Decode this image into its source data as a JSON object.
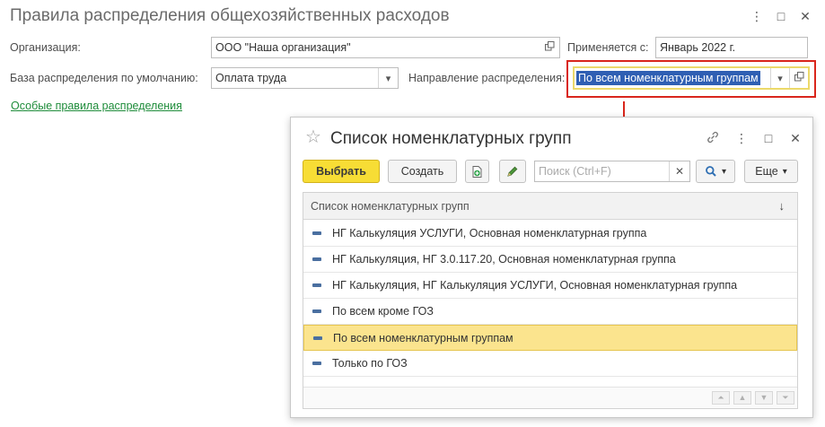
{
  "window": {
    "title": "Правила распределения общехозяйственных расходов",
    "menu_icon": "⋮",
    "maximize_icon": "□",
    "close_icon": "✕"
  },
  "form": {
    "org_label": "Организация:",
    "org_value": "ООО \"Наша организация\"",
    "applies_label": "Применяется с:",
    "applies_value": "Январь 2022 г.",
    "base_label": "База распределения по умолчанию:",
    "base_value": "Оплата труда",
    "direction_label": "Направление распределения:",
    "direction_value": "По всем номенклатурным группам",
    "special_rules_link": "Особые правила распределения"
  },
  "popup": {
    "title": "Список номенклатурных групп",
    "toolbar": {
      "select_label": "Выбрать",
      "create_label": "Создать",
      "search_placeholder": "Поиск (Ctrl+F)",
      "more_label": "Еще"
    },
    "table": {
      "column_header": "Список номенклатурных групп",
      "rows": [
        {
          "label": "НГ Калькуляция УСЛУГИ, Основная номенклатурная группа",
          "selected": false
        },
        {
          "label": "НГ Калькуляция, НГ 3.0.117.20, Основная номенклатурная группа",
          "selected": false
        },
        {
          "label": "НГ Калькуляция, НГ Калькуляция УСЛУГИ, Основная номенклатурная группа",
          "selected": false
        },
        {
          "label": "По всем кроме ГОЗ",
          "selected": false
        },
        {
          "label": "По всем номенклатурным группам",
          "selected": true
        },
        {
          "label": "Только по ГОЗ",
          "selected": false
        }
      ]
    }
  },
  "colors": {
    "highlight_frame": "#d9261c",
    "primary_button": "#f7dd35",
    "selected_row": "#fbe48e",
    "link": "#1e8c3a",
    "selection_text_bg": "#2f5fb3"
  }
}
